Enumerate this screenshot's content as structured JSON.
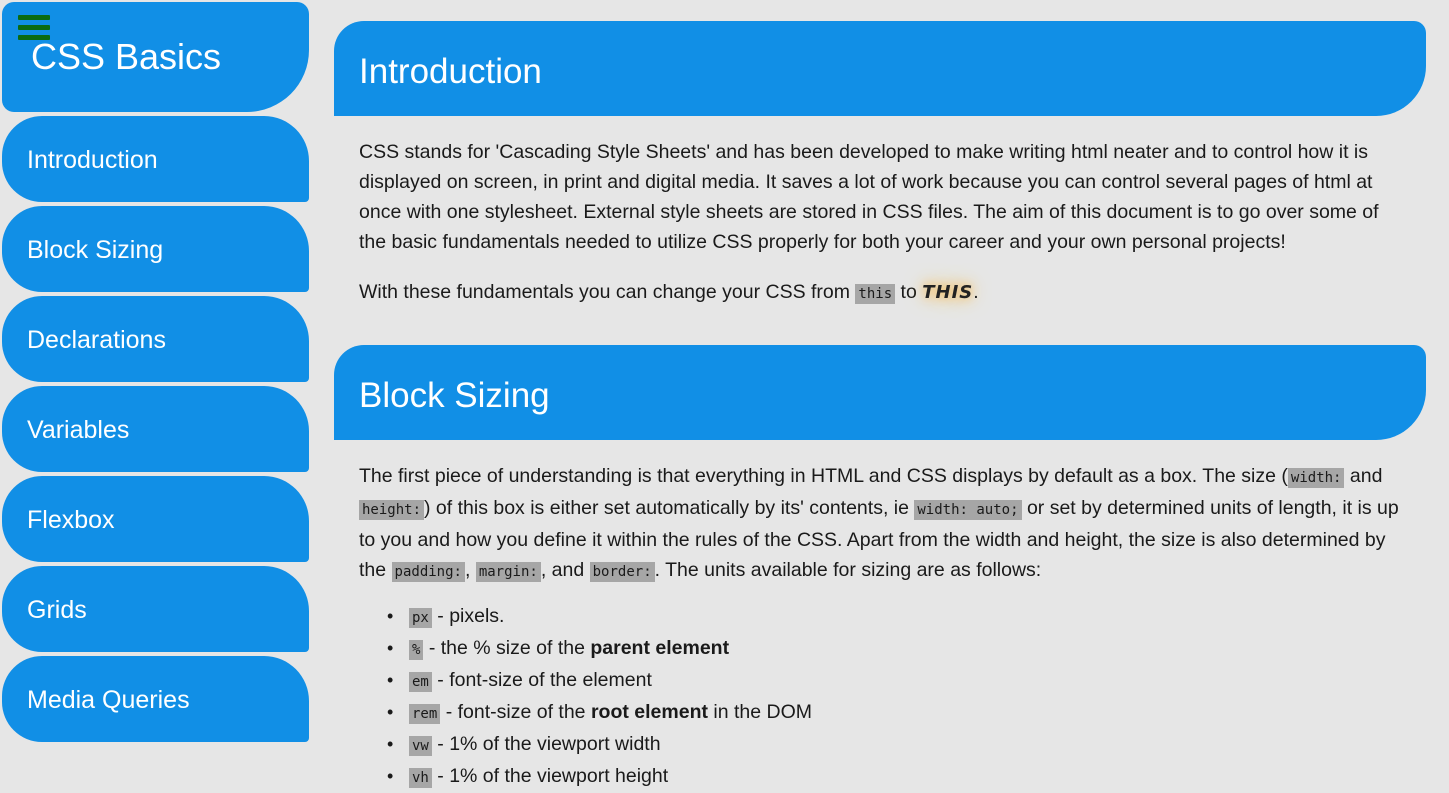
{
  "sidebar": {
    "title": "CSS Basics",
    "menu_icon": "hamburger-menu-icon",
    "items": [
      {
        "label": "Introduction"
      },
      {
        "label": "Block Sizing"
      },
      {
        "label": "Declarations"
      },
      {
        "label": "Variables"
      },
      {
        "label": "Flexbox"
      },
      {
        "label": "Grids"
      },
      {
        "label": "Media Queries"
      }
    ]
  },
  "colors": {
    "accent": "#118fe6",
    "background": "#e6e6e6",
    "menu_icon": "#0a6b12",
    "code_bg": "#a6a6a6"
  },
  "sections": {
    "introduction": {
      "title": "Introduction",
      "p1": "CSS stands for 'Cascading Style Sheets' and has been developed to make writing html neater and to control how it is displayed on screen, in print and digital media. It saves a lot of work because you can control several pages of html at once with one stylesheet. External style sheets are stored in CSS files. The aim of this document is to go over some of the basic fundamentals needed to utilize CSS properly for both your career and your own personal projects!",
      "p2_before": "With these fundamentals you can change your CSS from ",
      "p2_code": "this",
      "p2_mid": " to ",
      "p2_fancy": "THIS",
      "p2_after": "."
    },
    "block_sizing": {
      "title": "Block Sizing",
      "p_1": "The first piece of understanding is that everything in HTML and CSS displays by default as a box. The size (",
      "code_width": "width:",
      "p_2": " and ",
      "code_height": "height:",
      "p_3": ") of this box is either set automatically by its' contents, ie ",
      "code_auto": "width: auto;",
      "p_4": " or set by determined units of length, it is up to you and how you define it within the rules of the CSS. Apart from the width and height, the size is also determined by the ",
      "code_padding": "padding:",
      "p_5": ", ",
      "code_margin": "margin:",
      "p_6": ", and ",
      "code_border": "border:",
      "p_7": ". The units available for sizing are as follows:",
      "units": [
        {
          "code": "px",
          "before": " - pixels.",
          "bold": "",
          "after": ""
        },
        {
          "code": "%",
          "before": " - the % size of the ",
          "bold": "parent element",
          "after": ""
        },
        {
          "code": "em",
          "before": " - font-size of the element",
          "bold": "",
          "after": ""
        },
        {
          "code": "rem",
          "before": " - font-size of the ",
          "bold": "root element",
          "after": " in the DOM"
        },
        {
          "code": "vw",
          "before": " - 1% of the viewport width",
          "bold": "",
          "after": ""
        },
        {
          "code": "vh",
          "before": " - 1% of the viewport height",
          "bold": "",
          "after": ""
        }
      ]
    }
  }
}
